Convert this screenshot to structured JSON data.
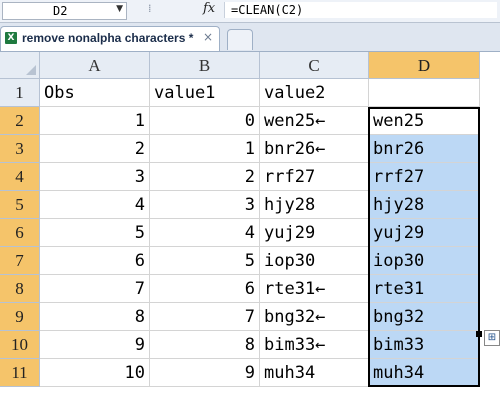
{
  "formula_bar": {
    "name_box": "D2",
    "dots": "⁞",
    "fx_label": "fx",
    "formula": "=CLEAN(C2)"
  },
  "tabs": {
    "document_title": "remove nonalpha characters *",
    "close_glyph": "×",
    "excel_icon_letter": "X"
  },
  "sheet": {
    "columns": [
      "A",
      "B",
      "C",
      "D"
    ],
    "selected_column": "D",
    "rows": [
      "1",
      "2",
      "3",
      "4",
      "5",
      "6",
      "7",
      "8",
      "9",
      "10",
      "11"
    ],
    "selected_rows": [
      "2",
      "3",
      "4",
      "5",
      "6",
      "7",
      "8",
      "9",
      "10",
      "11"
    ],
    "header_row": {
      "A": "Obs",
      "B": "value1",
      "C": "value2",
      "D": ""
    },
    "data": [
      {
        "A": "1",
        "B": "0",
        "C": "wen25←",
        "D": "wen25"
      },
      {
        "A": "2",
        "B": "1",
        "C": "bnr26←",
        "D": "bnr26"
      },
      {
        "A": "3",
        "B": "2",
        "C": "rrf27",
        "D": "rrf27"
      },
      {
        "A": "4",
        "B": "3",
        "C": "hjy28",
        "D": "hjy28"
      },
      {
        "A": "5",
        "B": "4",
        "C": "yuj29",
        "D": "yuj29"
      },
      {
        "A": "6",
        "B": "5",
        "C": "iop30",
        "D": "iop30"
      },
      {
        "A": "7",
        "B": "6",
        "C": "rte31←",
        "D": "rte31"
      },
      {
        "A": "8",
        "B": "7",
        "C": "bng32←",
        "D": "bng32"
      },
      {
        "A": "9",
        "B": "8",
        "C": "bim33←",
        "D": "bim33"
      },
      {
        "A": "10",
        "B": "9",
        "C": "muh34",
        "D": "muh34"
      }
    ],
    "selection_color": "#bcd8f5",
    "header_highlight_color": "#f5c46a"
  }
}
